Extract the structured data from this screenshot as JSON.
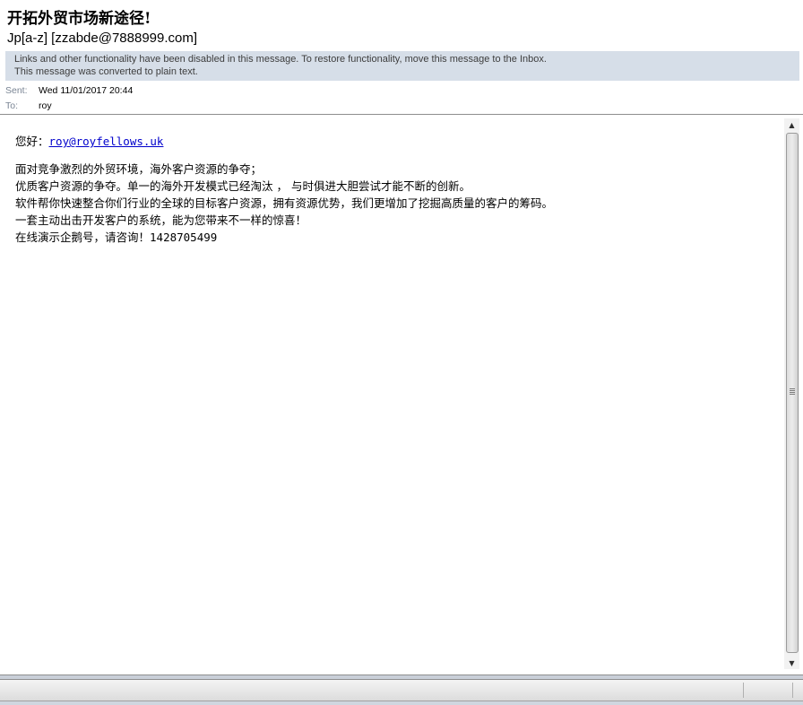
{
  "message": {
    "subject": "开拓外贸市场新途径!",
    "sender": "Jp[a-z] [zzabde@7888999.com]",
    "infobar": [
      "Links and other functionality have been disabled in this message. To restore functionality, move this message to the Inbox.",
      "This message was converted to plain text."
    ],
    "sent_label": "Sent:",
    "sent_value": "Wed 11/01/2017 20:44",
    "to_label": "To:",
    "to_value": "roy"
  },
  "body": {
    "greeting_prefix": "您好：",
    "greeting_link": "roy@royfellows.uk",
    "lines": [
      "面对竞争激烈的外贸环境，海外客户资源的争夺；",
      "优质客户资源的争夺。单一的海外开发模式已经淘汰 ， 与时俱进大胆尝试才能不断的创新。",
      "软件帮你快速整合你们行业的全球的目标客户资源，拥有资源优势，我们更增加了挖掘高质量的客户的筹码。",
      "一套主动出击开发客户的系统，能为您带来不一样的惊喜！"
    ],
    "last_line_prefix": "在线演示企鹅号，请咨询！",
    "last_line_number": "1428705499"
  },
  "icons": {
    "scroll_up": "▲",
    "scroll_down": "▼"
  }
}
